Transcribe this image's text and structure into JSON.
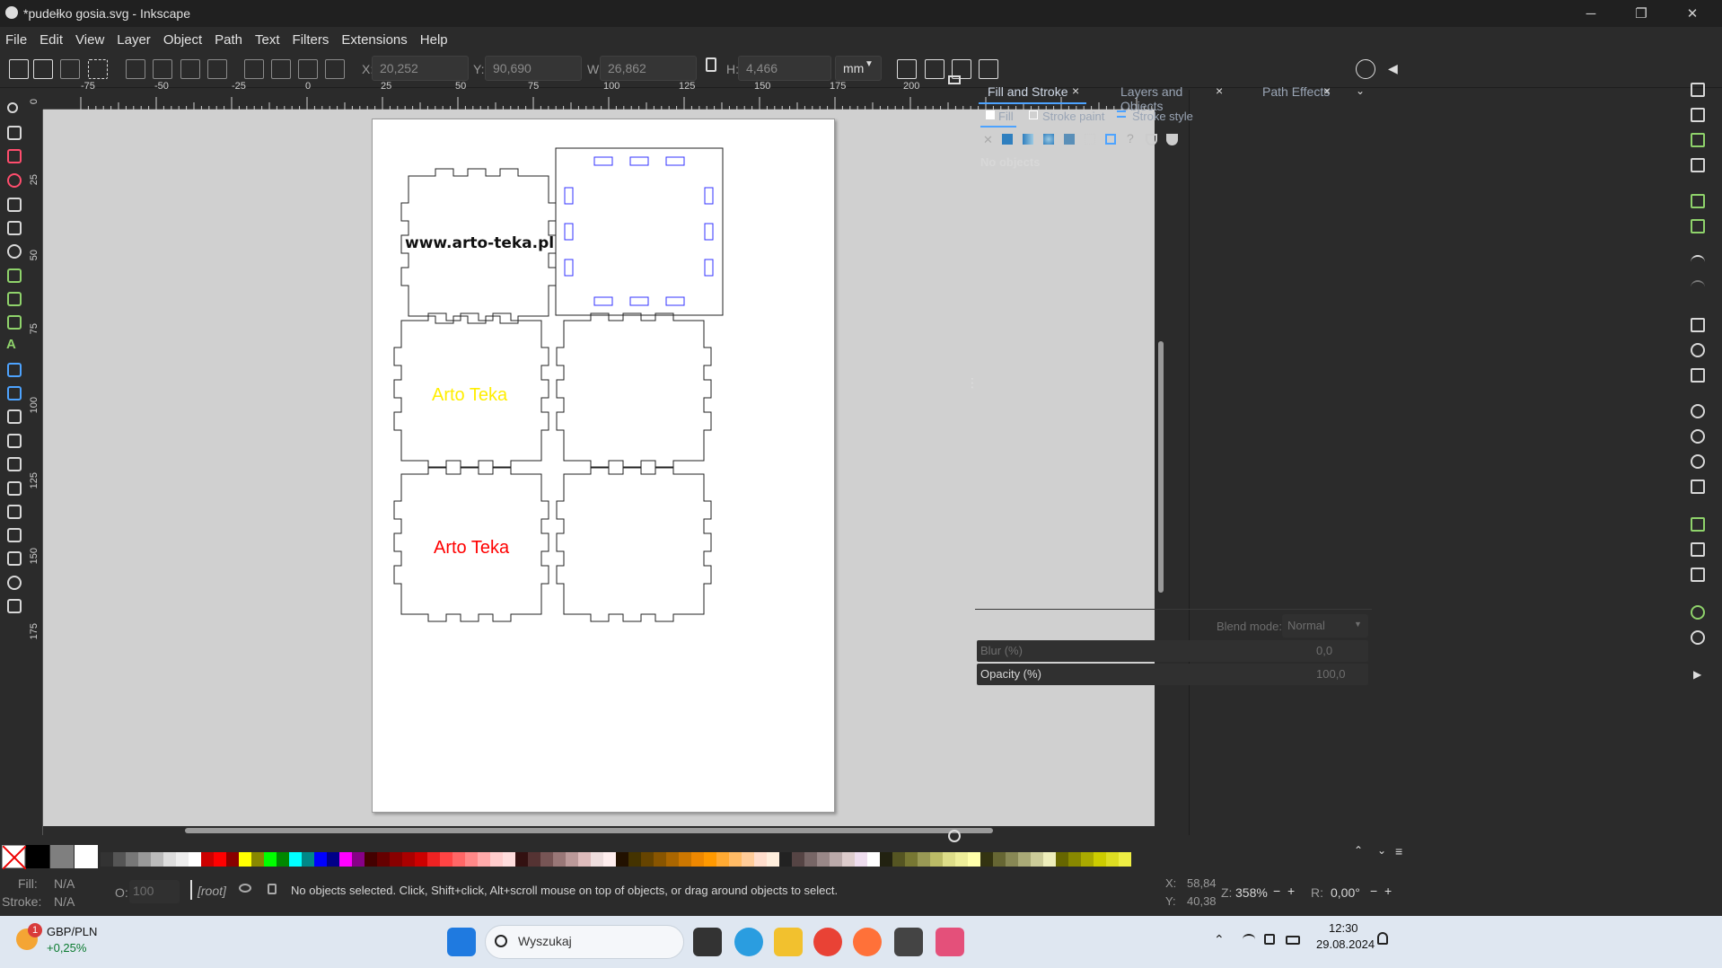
{
  "window": {
    "title": "*pudełko gosia.svg - Inkscape",
    "minimize": "─",
    "restore": "❐",
    "close": "✕"
  },
  "menu": [
    "File",
    "Edit",
    "View",
    "Layer",
    "Object",
    "Path",
    "Text",
    "Filters",
    "Extensions",
    "Help"
  ],
  "toolbar": {
    "x_label": "X:",
    "x_value": "20,252",
    "y_label": "Y:",
    "y_value": "90,690",
    "w_label": "W:",
    "w_value": "26,862",
    "h_label": "H:",
    "h_value": "4,466",
    "unit": "mm"
  },
  "ruler_h": [
    "-75",
    "-50",
    "-25",
    "0",
    "25",
    "50",
    "75",
    "100",
    "125",
    "150",
    "175",
    "200"
  ],
  "ruler_v": [
    "0",
    "25",
    "50",
    "75",
    "100",
    "125",
    "150",
    "175"
  ],
  "canvas": {
    "text_url": "www.arto-teka.pl",
    "text_yellow": "Arto Teka",
    "text_red": "Arto Teka",
    "yellow": "#ffee00",
    "red": "#ff0000"
  },
  "dialog": {
    "tabs": [
      "Fill and Stroke",
      "Layers and Objects",
      "Path Effects"
    ],
    "subtabs": [
      "Fill",
      "Stroke paint",
      "Stroke style"
    ],
    "no_objects": "No objects",
    "blend_label": "Blend mode:",
    "blend_value": "Normal",
    "blur_label": "Blur (%)",
    "blur_value": "0,0",
    "opacity_label": "Opacity (%)",
    "opacity_value": "100,0"
  },
  "status": {
    "fill_label": "Fill:",
    "fill_value": "N/A",
    "stroke_label": "Stroke:",
    "stroke_value": "N/A",
    "o_label": "O:",
    "o_value": "100",
    "layer": "[root]",
    "message": "No objects selected. Click, Shift+click, Alt+scroll mouse on top of objects, or drag around objects to select.",
    "x_label": "X:",
    "x_value": "58,84",
    "y_label": "Y:",
    "y_value": "40,38",
    "z_label": "Z:",
    "zoom": "358%",
    "r_label": "R:",
    "rotation": "0,00°"
  },
  "taskbar": {
    "ticker": "GBP/PLN",
    "ticker_change": "+0,25%",
    "badge": "1",
    "search_placeholder": "Wyszukaj",
    "time": "12:30",
    "date": "29.08.2024"
  }
}
